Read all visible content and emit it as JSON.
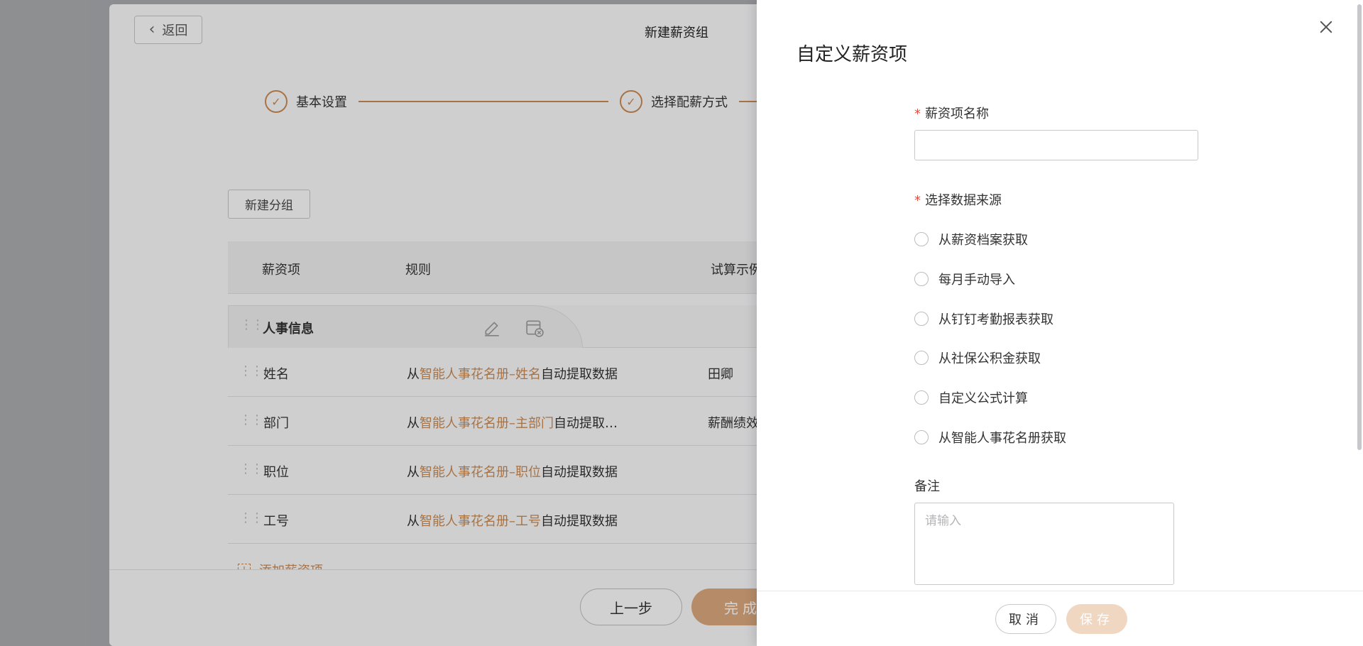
{
  "background": {
    "back_label": "返回",
    "page_title": "新建薪资组",
    "steps": [
      {
        "label": "基本设置"
      },
      {
        "label": "选择配薪方式"
      }
    ],
    "new_group_label": "新建分组",
    "table": {
      "headers": [
        "薪资项",
        "规则",
        "试算示例"
      ],
      "group_name": "人事信息",
      "rows": [
        {
          "name": "姓名",
          "rule_prefix": "从",
          "rule_source": "智能人事花名册–姓名",
          "rule_suffix": "自动提取数据",
          "example": "田卿"
        },
        {
          "name": "部门",
          "rule_prefix": "从",
          "rule_source": "智能人事花名册–主部门",
          "rule_suffix": "自动提取…",
          "example": "薪酬绩效"
        },
        {
          "name": "职位",
          "rule_prefix": "从",
          "rule_source": "智能人事花名册–职位",
          "rule_suffix": "自动提取数据",
          "example": ""
        },
        {
          "name": "工号",
          "rule_prefix": "从",
          "rule_source": "智能人事花名册–工号",
          "rule_suffix": "自动提取数据",
          "example": ""
        }
      ],
      "add_item_label": "添加薪资项"
    },
    "prev_label": "上一步",
    "finish_label": "完成"
  },
  "drawer": {
    "title": "自定义薪资项",
    "name_label": "薪资项名称",
    "name_value": "",
    "source_label": "选择数据来源",
    "source_options": [
      "从薪资档案获取",
      "每月手动导入",
      "从钉钉考勤报表获取",
      "从社保公积金获取",
      "自定义公式计算",
      "从智能人事花名册获取"
    ],
    "remark_label": "备注",
    "remark_placeholder": "请输入",
    "cancel_label": "取消",
    "save_label": "保存"
  },
  "colors": {
    "accent": "#c98a52",
    "required": "#e34d3d",
    "save_disabled": "#f0d7c1"
  }
}
